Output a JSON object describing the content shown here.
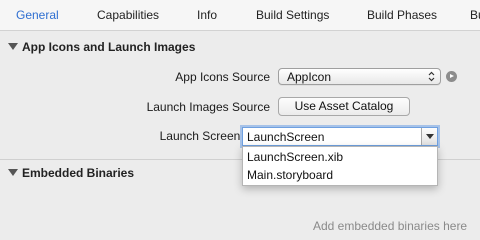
{
  "tabs": [
    {
      "label": "General",
      "active": true
    },
    {
      "label": "Capabilities",
      "active": false
    },
    {
      "label": "Info",
      "active": false
    },
    {
      "label": "Build Settings",
      "active": false
    },
    {
      "label": "Build Phases",
      "active": false
    },
    {
      "label": "Bu",
      "active": false
    }
  ],
  "app_icons_section": {
    "title": "App Icons and Launch Images",
    "app_icons_source_label": "App Icons Source",
    "app_icons_source_value": "AppIcon",
    "launch_images_source_label": "Launch Images Source",
    "launch_images_button": "Use Asset Catalog",
    "launch_screen_file_label": "Launch Screen File",
    "launch_screen_file_value": "LaunchScreen",
    "launch_screen_options": [
      "LaunchScreen.xib",
      "Main.storyboard"
    ]
  },
  "embedded_section": {
    "title": "Embedded Binaries",
    "hint": "Add embedded binaries here"
  },
  "colors": {
    "accent": "#2f6fd1",
    "background": "#ececec",
    "focus_ring": "#6fa0e0"
  },
  "icons": {
    "disclosure": "disclosure-triangle-icon",
    "navigate": "arrow-circle-icon",
    "popup_arrows": "updown-chevron-icon",
    "combo_arrow": "chevron-down-icon"
  }
}
